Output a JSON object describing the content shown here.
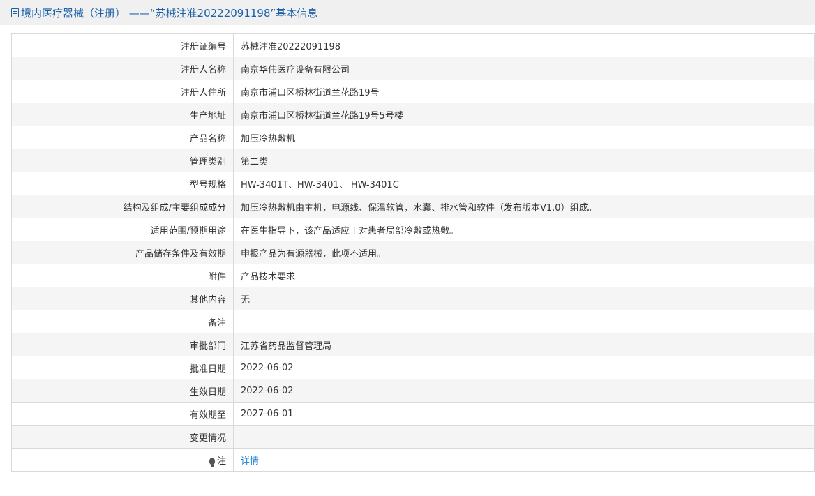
{
  "page": {
    "title": "境内医疗器械（注册） ——“苏械注准20222091198”基本信息"
  },
  "rows": [
    {
      "label": "注册证编号",
      "value": "苏械注准20222091198"
    },
    {
      "label": "注册人名称",
      "value": "南京华伟医疗设备有限公司"
    },
    {
      "label": "注册人住所",
      "value": "南京市浦口区桥林街道兰花路19号"
    },
    {
      "label": "生产地址",
      "value": "南京市浦口区桥林街道兰花路19号5号楼"
    },
    {
      "label": "产品名称",
      "value": "加压冷热敷机"
    },
    {
      "label": "管理类别",
      "value": "第二类"
    },
    {
      "label": "型号规格",
      "value": "HW-3401T、HW-3401、 HW-3401C"
    },
    {
      "label": "结构及组成/主要组成成分",
      "value": "加压冷热敷机由主机，电源线、保温软管，水囊、排水管和软件（发布版本V1.0）组成。"
    },
    {
      "label": "适用范围/预期用途",
      "value": "在医生指导下，该产品适应于对患者局部冷敷或热敷。"
    },
    {
      "label": "产品储存条件及有效期",
      "value": "申报产品为有源器械，此项不适用。"
    },
    {
      "label": "附件",
      "value": "产品技术要求"
    },
    {
      "label": "其他内容",
      "value": "无"
    },
    {
      "label": "备注",
      "value": ""
    },
    {
      "label": "审批部门",
      "value": "江苏省药品监督管理局"
    },
    {
      "label": "批准日期",
      "value": "2022-06-02"
    },
    {
      "label": "生效日期",
      "value": "2022-06-02"
    },
    {
      "label": "有效期至",
      "value": "2027-06-01"
    },
    {
      "label": "变更情况",
      "value": ""
    }
  ],
  "note": {
    "icon": "bulb-icon",
    "label": "注",
    "link_text": "详情"
  },
  "colors": {
    "title": "#1a5fa8",
    "link": "#1a7fd4",
    "row_alt": "#f5f5f5",
    "border": "#d9d9d9"
  }
}
